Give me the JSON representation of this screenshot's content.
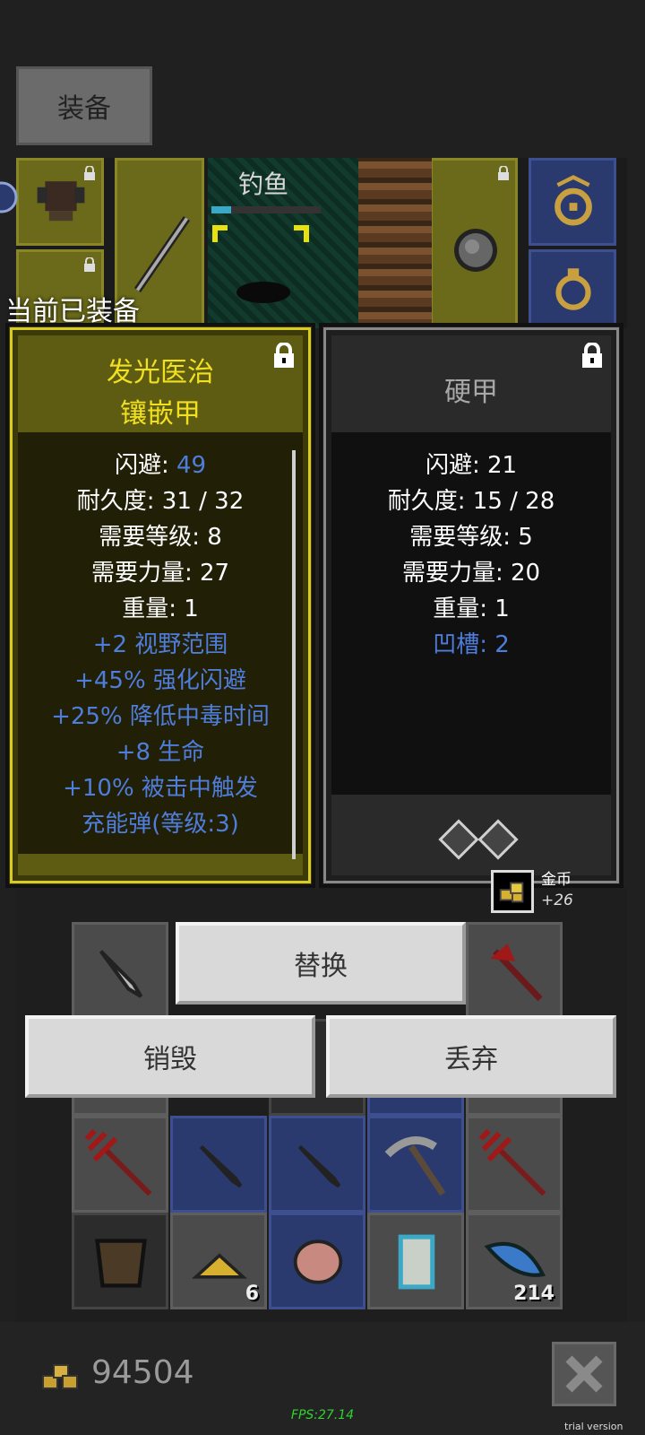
{
  "tabs": {
    "equip_label": "装备"
  },
  "scene": {
    "fishing_label": "钓鱼",
    "fishing_progress": 0.18
  },
  "equipped_title": "当前已装备",
  "left_card": {
    "name_line1": "发光医治",
    "name_line2": "镶嵌甲",
    "stats": [
      {
        "label": "闪避: ",
        "value": "49"
      },
      {
        "label": "耐久度: 31 / 32",
        "value": ""
      },
      {
        "label": "需要等级: 8",
        "value": ""
      },
      {
        "label": "需要力量: 27",
        "value": ""
      },
      {
        "label": "重量: 1",
        "value": ""
      }
    ],
    "bonuses": [
      "+2 视野范围",
      "+45% 强化闪避",
      "+25% 降低中毒时间",
      "+8 生命",
      "+10% 被击中触发",
      "充能弹(等级:3)"
    ]
  },
  "right_card": {
    "name": "硬甲",
    "stats": [
      "闪避: 21",
      "耐久度: 15 / 28",
      "需要等级: 5",
      "需要力量: 20",
      "重量: 1"
    ],
    "sockets": "凹槽: 2"
  },
  "coin_popup": {
    "label": "金币",
    "amount": "+26"
  },
  "buttons": {
    "replace": "替换",
    "destroy": "销毁",
    "discard": "丢弃"
  },
  "inventory": {
    "gold_count": "6",
    "feather_count": "214"
  },
  "bottom": {
    "gold": "94504",
    "fps": "FPS:27.14",
    "trial": "trial version"
  },
  "colors": {
    "gold_accent": "#d8cc22",
    "bonus_blue": "#4f7ddb",
    "fps_green": "#2ed42e"
  }
}
